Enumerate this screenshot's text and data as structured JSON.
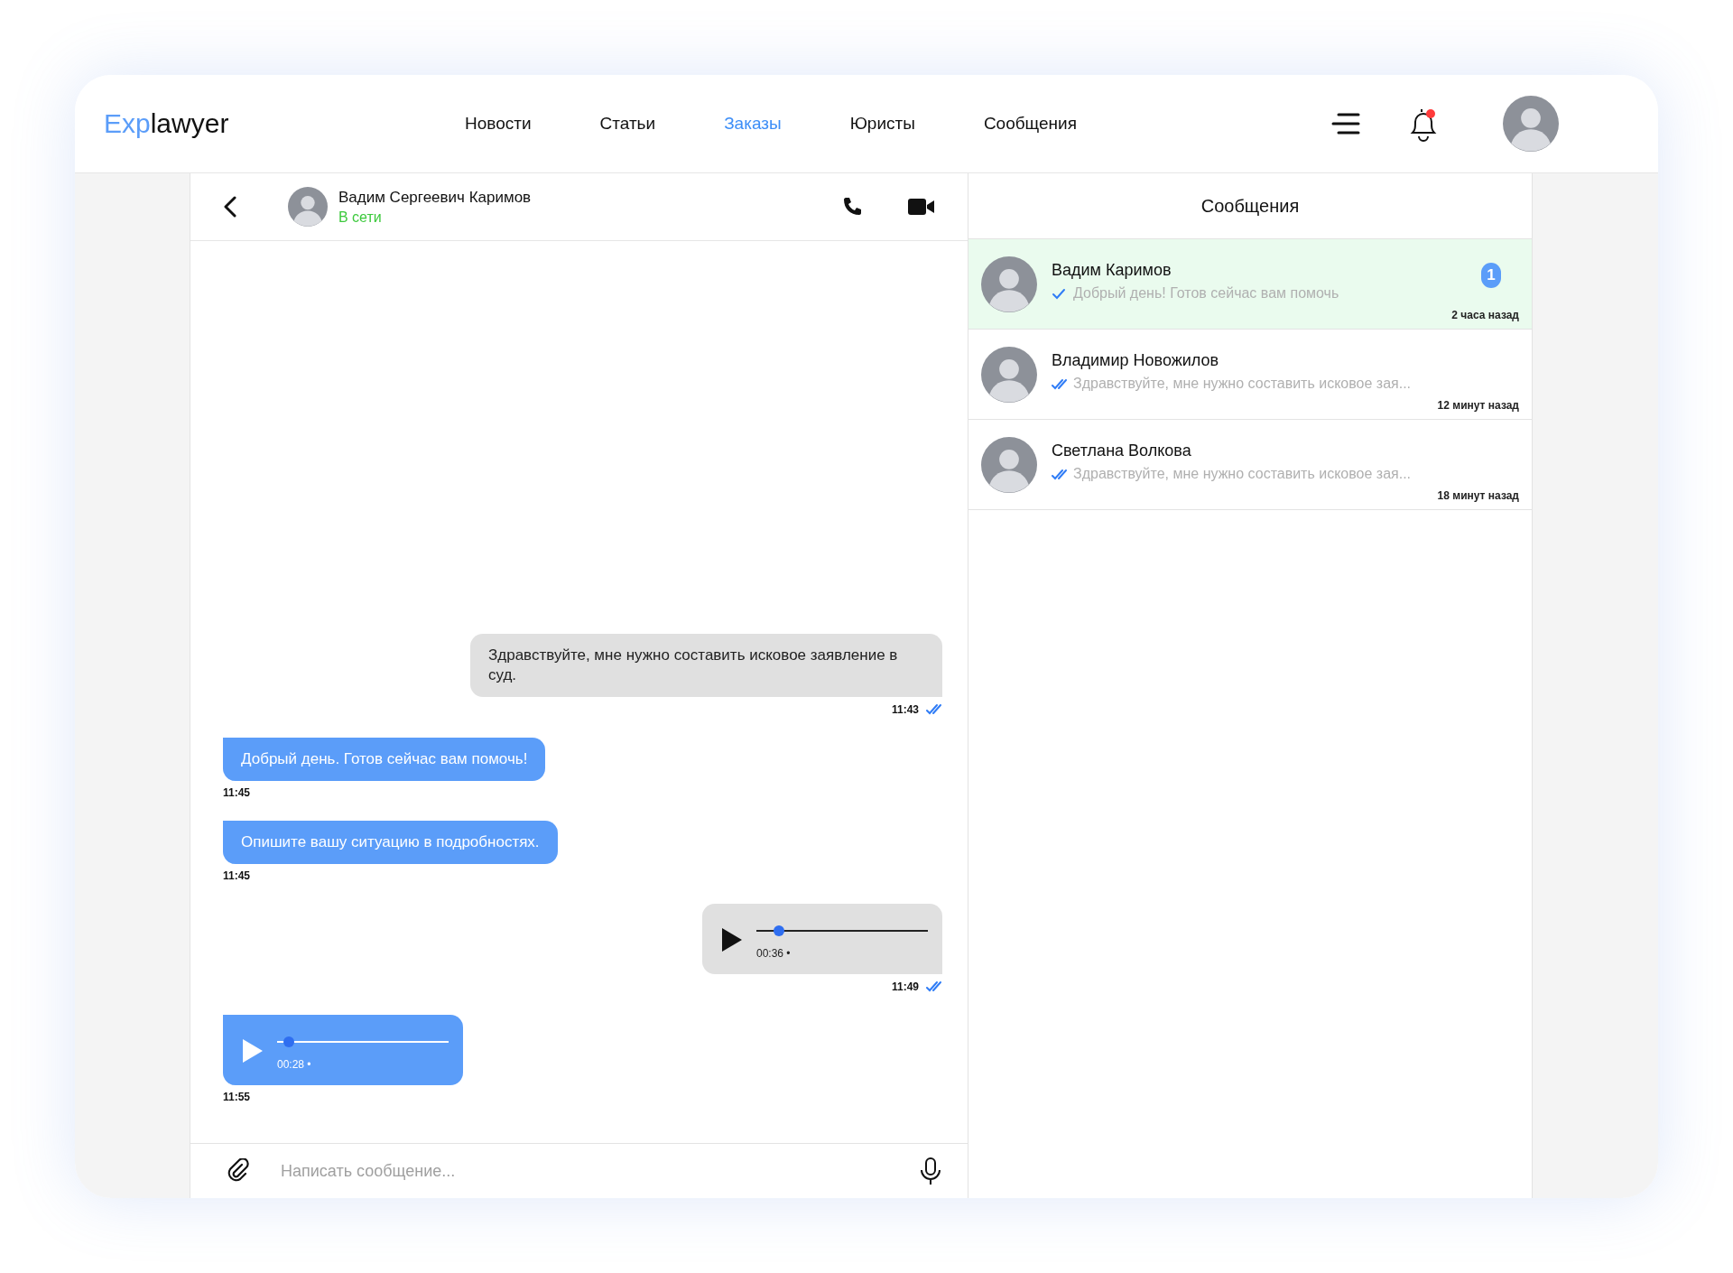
{
  "header": {
    "logo": {
      "accent": "Exp",
      "rest": "lawyer"
    },
    "nav": [
      {
        "label": "Новости",
        "selected": false
      },
      {
        "label": "Статьи",
        "selected": false
      },
      {
        "label": "Заказы",
        "selected": true
      },
      {
        "label": "Юристы",
        "selected": false
      },
      {
        "label": "Сообщения",
        "selected": false
      }
    ],
    "has_notification": true
  },
  "chat": {
    "contact": {
      "name": "Вадим Сергеевич Каримов",
      "status": "В сети"
    },
    "messages": [
      {
        "kind": "text",
        "outgoing": true,
        "text": "Здравствуйте, мне нужно составить исковое заявление в суд.",
        "time": "11:43",
        "read": true
      },
      {
        "kind": "text",
        "outgoing": false,
        "text": "Добрый день. Готов сейчас вам помочь!",
        "time": "11:45"
      },
      {
        "kind": "text",
        "outgoing": false,
        "text": "Опишите вашу ситуацию в подробностях.",
        "time": "11:45"
      },
      {
        "kind": "voice",
        "outgoing": true,
        "duration": "00:36 •",
        "level": 0.13,
        "time": "11:49",
        "read": true
      },
      {
        "kind": "voice",
        "outgoing": false,
        "duration": "00:28 •",
        "level": 0.07,
        "time": "11:55"
      }
    ],
    "input": {
      "placeholder": "Написать сообщение..."
    }
  },
  "list": {
    "title": "Сообщения",
    "conversations": [
      {
        "name": "Вадим Каримов",
        "preview": "Добрый день! Готов сейчас вам помочь",
        "time": "2 часа назад",
        "read": false,
        "unread": "1",
        "selected": true
      },
      {
        "name": "Владимир Новожилов",
        "preview": "Здравствуйте, мне нужно составить исковое зая...",
        "time": "12 минут назад",
        "read": true,
        "selected": false
      },
      {
        "name": "Светлана Волкова",
        "preview": "Здравствуйте, мне нужно составить исковое зая...",
        "time": "18 минут назад",
        "read": true,
        "selected": false
      }
    ]
  }
}
